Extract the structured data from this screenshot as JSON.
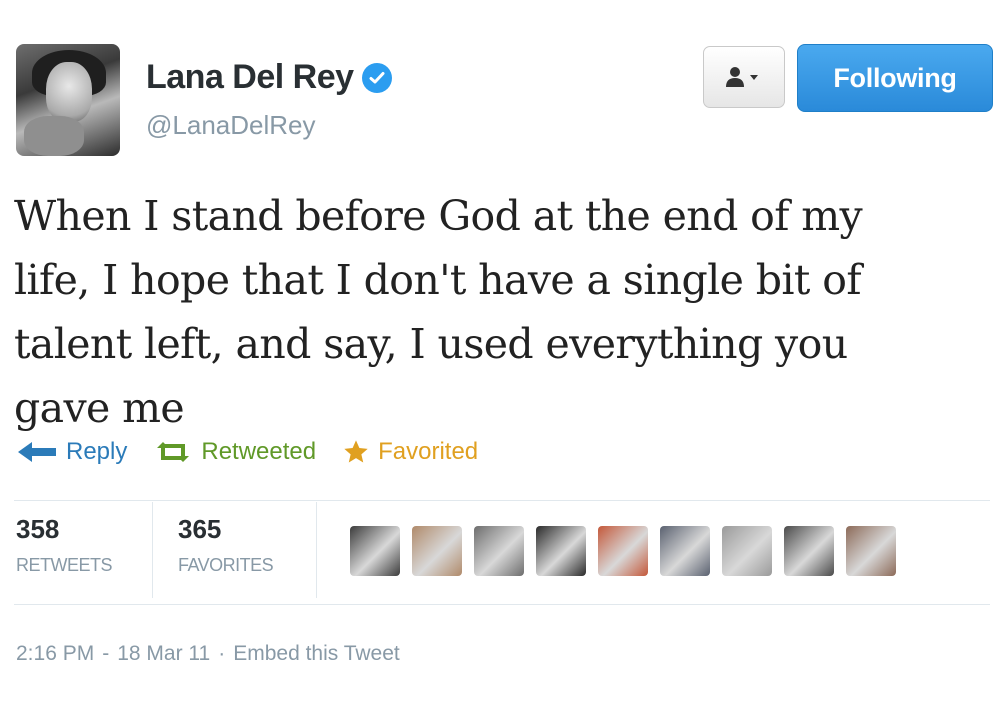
{
  "user": {
    "display_name": "Lana Del Rey",
    "handle": "@LanaDelRey",
    "avatar_icon": "profile-photo",
    "verified_icon": "verified-badge-icon",
    "verified_color": "#2b9df0"
  },
  "header": {
    "user_dropdown_icon": "user-dropdown-icon",
    "following_label": "Following",
    "following_color": "#3a98e4"
  },
  "tweet": {
    "text": "When I stand before God at the end of my\nlife, I hope that I don't have a single bit of\ntalent left, and say, I used everything you\ngave me"
  },
  "actions": {
    "reply_label": "Reply",
    "retweet_label": "Retweeted",
    "favorite_label": "Favorited",
    "reply_color": "#2b7bb9",
    "retweet_color": "#609928",
    "favorite_color": "#e0a020"
  },
  "stats": {
    "retweets_count": "358",
    "retweets_label": "RETWEETS",
    "favorites_count": "365",
    "favorites_label": "FAVORITES"
  },
  "favoriters": [
    {
      "icon": "avatar-1",
      "color": "#3b3b3b"
    },
    {
      "icon": "avatar-2",
      "color": "#b08a6a"
    },
    {
      "icon": "avatar-3",
      "color": "#6d6d6d"
    },
    {
      "icon": "avatar-4",
      "color": "#2a2a2a"
    },
    {
      "icon": "avatar-5",
      "color": "#c4583a"
    },
    {
      "icon": "avatar-6",
      "color": "#5a6170"
    },
    {
      "icon": "avatar-7",
      "color": "#9a9a9a"
    },
    {
      "icon": "avatar-8",
      "color": "#4a4a4a"
    },
    {
      "icon": "avatar-9",
      "color": "#8c6a58"
    }
  ],
  "footer": {
    "time": "2:16 PM",
    "date": "18 Mar 11",
    "embed_label": "Embed this Tweet"
  }
}
